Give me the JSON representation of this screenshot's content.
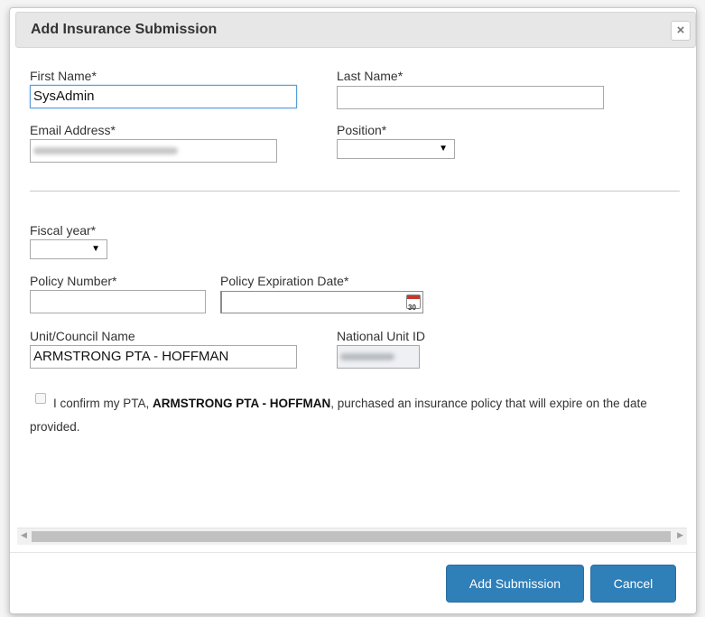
{
  "modal": {
    "title": "Add Insurance Submission",
    "close_glyph": "×"
  },
  "form": {
    "first_name": {
      "label": "First Name*",
      "value": "SysAdmin"
    },
    "last_name": {
      "label": "Last Name*",
      "value": ""
    },
    "email": {
      "label": "Email Address*",
      "value_state": "redacted/blurred"
    },
    "position": {
      "label": "Position*",
      "selected": ""
    },
    "fiscal_year": {
      "label": "Fiscal year*",
      "selected": ""
    },
    "policy_number": {
      "label": "Policy Number*",
      "value": ""
    },
    "policy_expiration": {
      "label": "Policy Expiration Date*",
      "value": "",
      "calendar_day": "30"
    },
    "unit_name": {
      "label": "Unit/Council Name",
      "value": "ARMSTRONG PTA - HOFFMAN"
    },
    "national_unit_id": {
      "label": "National Unit ID",
      "value_state": "redacted/blurred"
    }
  },
  "confirm": {
    "prefix": "I confirm my PTA, ",
    "unit": "ARMSTRONG PTA - HOFFMAN",
    "suffix": ", purchased an insurance policy that will expire on the date provided.",
    "checked": false
  },
  "footer": {
    "add_label": "Add Submission",
    "cancel_label": "Cancel"
  },
  "icons": {
    "close": "close-icon",
    "dropdown": "chevron-down-icon",
    "calendar": "calendar-icon",
    "scroll_left": "arrow-left-icon",
    "scroll_right": "arrow-right-icon"
  },
  "colors": {
    "primary_button": "#2f7fb8",
    "focus_border": "#5b9dd9",
    "header_bg": "#e7e7e7"
  }
}
